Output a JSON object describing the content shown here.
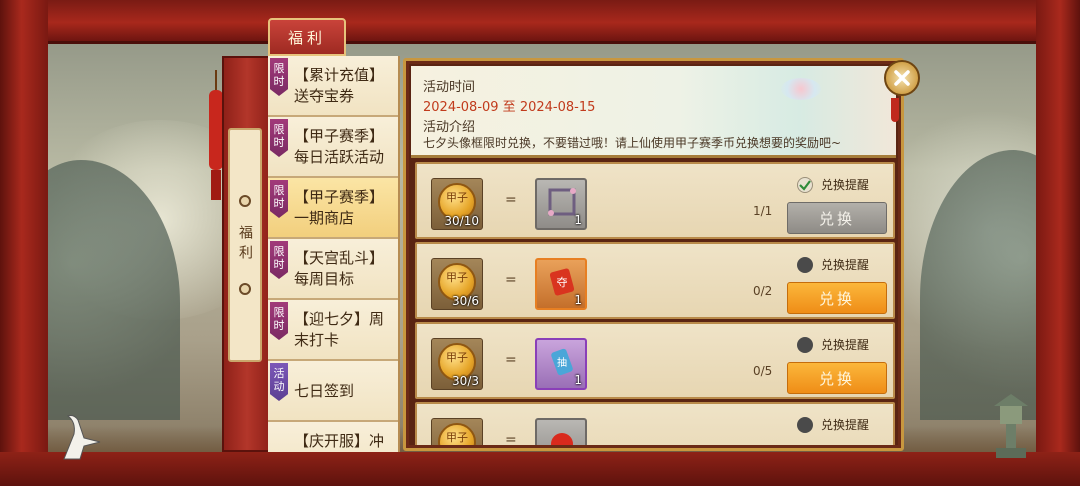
{
  "header": {
    "top_tab": "福利"
  },
  "side_panel": {
    "label": "福利"
  },
  "menu": {
    "items": [
      {
        "badge": "限时",
        "badge_color": "#a23a7a",
        "text": "【累计充值】送夺宝券",
        "active": false
      },
      {
        "badge": "限时",
        "badge_color": "#a23a7a",
        "text": "【甲子赛季】每日活跃活动",
        "active": false
      },
      {
        "badge": "限时",
        "badge_color": "#a23a7a",
        "text": "【甲子赛季】一期商店",
        "active": true
      },
      {
        "badge": "限时",
        "badge_color": "#a23a7a",
        "text": "【天宫乱斗】每周目标",
        "active": false
      },
      {
        "badge": "限时",
        "badge_color": "#a23a7a",
        "text": "【迎七夕】周末打卡",
        "active": false
      },
      {
        "badge": "活动",
        "badge_color": "#7c58b8",
        "text": "七日签到",
        "active": false
      },
      {
        "badge": "",
        "badge_color": "",
        "text": "【庆开服】冲",
        "active": false
      }
    ]
  },
  "info": {
    "time_label": "活动时间",
    "time_range": "2024-08-09 至 2024-08-15",
    "intro_label": "活动介绍",
    "intro_text": "七夕头像框限时兑换，不要错过哦！请上仙使用甲子赛季币兑换想要的奖励吧~"
  },
  "coin": {
    "glyph": "甲子",
    "icon": "jiazi-season-coin-icon"
  },
  "rows": [
    {
      "cost": "30/10",
      "equals": "=",
      "reward_icon": "avatar-frame-icon",
      "reward_count": "1",
      "reward_quality": "gray",
      "progress": "1/1",
      "remind_label": "兑换提醒",
      "remind_checked": true,
      "button": "兑换",
      "button_enabled": false
    },
    {
      "cost": "30/6",
      "equals": "=",
      "reward_icon": "seize-treasure-ticket-icon",
      "reward_glyph": "夺",
      "reward_count": "1",
      "reward_quality": "orange",
      "progress": "0/2",
      "remind_label": "兑换提醒",
      "remind_checked": false,
      "button": "兑换",
      "button_enabled": true
    },
    {
      "cost": "30/3",
      "equals": "=",
      "reward_icon": "scroll-ticket-icon",
      "reward_glyph": "抽",
      "reward_count": "1",
      "reward_quality": "purple",
      "progress": "0/5",
      "remind_label": "兑换提醒",
      "remind_checked": false,
      "button": "兑换",
      "button_enabled": true
    },
    {
      "cost": "",
      "equals": "=",
      "reward_icon": "red-envelope-icon",
      "reward_count": "",
      "reward_quality": "gray",
      "progress": "",
      "remind_label": "兑换提醒",
      "remind_checked": false,
      "button": "",
      "button_enabled": true
    }
  ]
}
